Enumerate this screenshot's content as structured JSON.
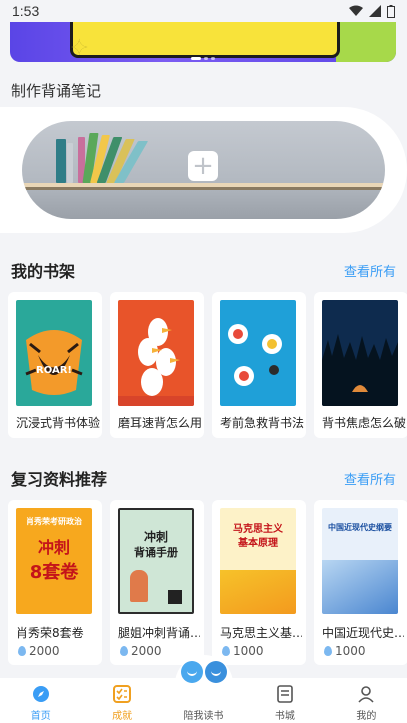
{
  "status_bar": {
    "time": "1:53"
  },
  "notes": {
    "title": "制作背诵笔记",
    "add_symbol": "+"
  },
  "shelf": {
    "title": "我的书架",
    "see_all": "查看所有",
    "books": [
      {
        "title": "沉浸式背书体验",
        "cover_color": "#2aa89a",
        "cover_text": "ROAR!"
      },
      {
        "title": "磨耳速背怎么用",
        "cover_color": "#e8542a"
      },
      {
        "title": "考前急救背书法",
        "cover_color": "#1fa0d8"
      },
      {
        "title": "背书焦虑怎么破",
        "cover_color": "#0e2b4e"
      }
    ]
  },
  "recommend": {
    "title": "复习资料推荐",
    "see_all": "查看所有",
    "items": [
      {
        "title": "肖秀荣8套卷",
        "points": "2000",
        "cover_color": "#f7a81e",
        "cover_lines": [
          "肖秀荣考研政治",
          "冲刺",
          "8套卷"
        ]
      },
      {
        "title": "腿姐冲刺背诵…",
        "points": "2000",
        "cover_color": "#cfe6d6",
        "cover_lines": [
          "冲刺",
          "背诵手册"
        ]
      },
      {
        "title": "马克思主义基…",
        "points": "1000",
        "cover_color": "#f6c22a",
        "cover_lines": [
          "马克思主义",
          "基本原理"
        ]
      },
      {
        "title": "中国近现代史…",
        "points": "1000",
        "cover_color": "#e8f0fa",
        "cover_lines": [
          "中国近现代史纲要"
        ]
      }
    ]
  },
  "bottom_nav": [
    {
      "label": "首页",
      "icon": "compass-icon"
    },
    {
      "label": "成就",
      "icon": "checklist-icon"
    },
    {
      "label": "陪我读书",
      "icon": "reading-buddies-icon"
    },
    {
      "label": "书城",
      "icon": "book-store-icon"
    },
    {
      "label": "我的",
      "icon": "profile-icon"
    }
  ]
}
